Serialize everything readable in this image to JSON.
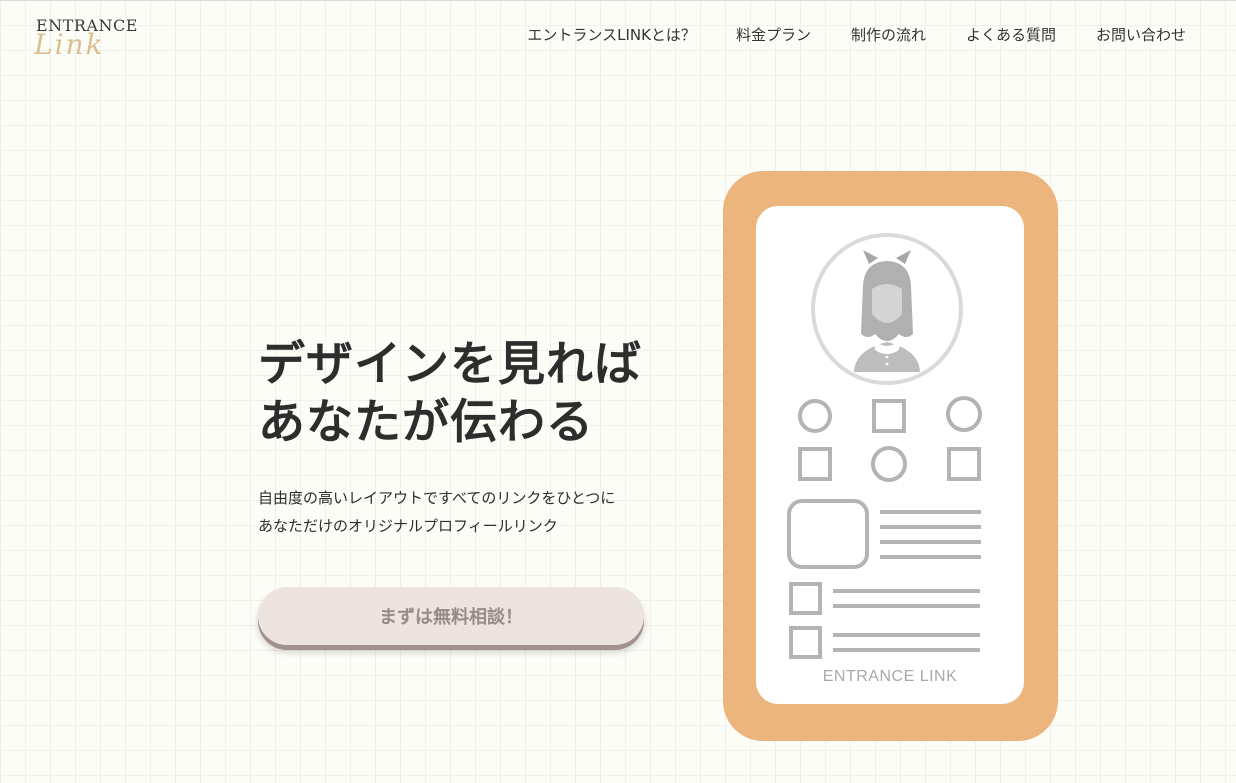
{
  "brand": {
    "logo_top": "ENTRANCE",
    "logo_script": "Link"
  },
  "nav": [
    {
      "label": "エントランスLINKとは？"
    },
    {
      "label": "料金プラン"
    },
    {
      "label": "制作の流れ"
    },
    {
      "label": "よくある質問"
    },
    {
      "label": "お問い合わせ"
    }
  ],
  "hero": {
    "title_line1": "デザインを見れば",
    "title_line2": "あなたが伝わる",
    "subtitle_line1": "自由度の高いレイアウトですべてのリンクをひとつに",
    "subtitle_line2": "あなただけのオリジナルプロフィールリンク",
    "cta_label": "まずは無料相談！"
  },
  "mockup": {
    "brand_label": "ENTRANCE LINK"
  },
  "colors": {
    "phone_frame": "#edb57e",
    "cta_bg": "#ede3df",
    "cta_text": "#9a8b86",
    "icon_gray": "#b4b4b4"
  }
}
